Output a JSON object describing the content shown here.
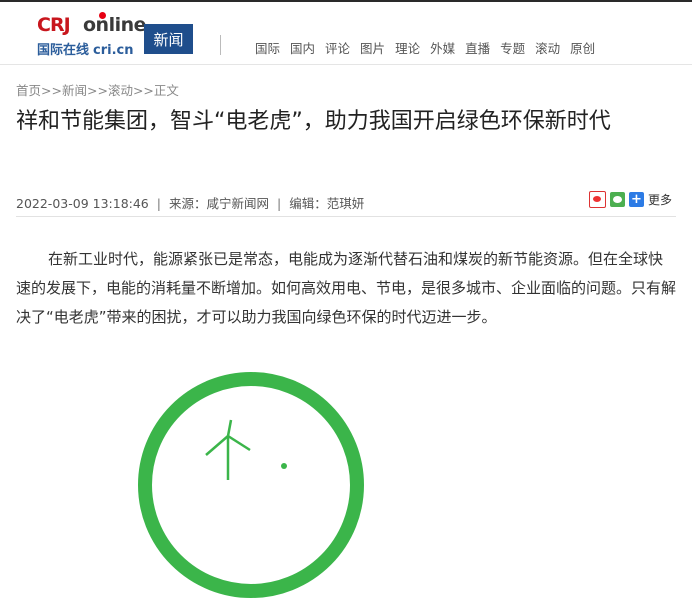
{
  "logo": {
    "cri": "CRJ",
    "online": "online",
    "cn_name": "国际在线",
    "domain": "cri.cn"
  },
  "news_badge": "新闻",
  "nav": [
    "国际",
    "国内",
    "评论",
    "图片",
    "理论",
    "外媒",
    "直播",
    "专题",
    "滚动",
    "原创"
  ],
  "breadcrumb": {
    "home": "首页",
    "news": "新闻",
    "scroll": "滚动",
    "body": "正文",
    "sep": ">>"
  },
  "article": {
    "title": "祥和节能集团，智斗“电老虎”，助力我国开启绿色环保新时代",
    "datetime": "2022-03-09 13:18:46",
    "source": "来源：咸宁新闻网",
    "editor": "编辑：范琪妍",
    "paragraph": "在新工业时代，能源紧张已是常态，电能成为逐渐代替石油和煤炭的新节能资源。但在全球快速的发展下，电能的消耗量不断增加。如何高效用电、节电，是很多城市、企业面临的问题。只有解决了“电老虎”带来的困扰，才可以助力我国向绿色环保的时代迈进一步。"
  },
  "share": {
    "more": "更多",
    "icons": [
      "weibo-icon",
      "wechat-icon",
      "plus-icon"
    ]
  },
  "colors": {
    "brand_red": "#c8161d",
    "brand_blue": "#1f4e8c",
    "illus_green": "#3bb54a"
  }
}
